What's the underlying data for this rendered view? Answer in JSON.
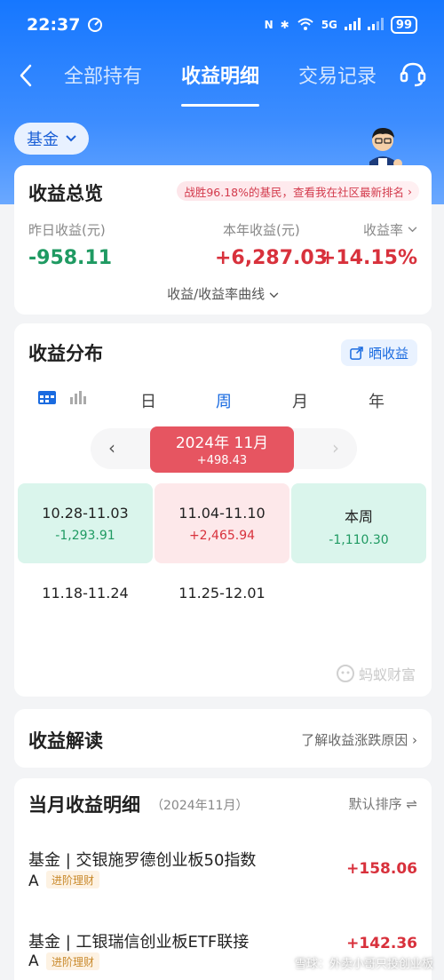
{
  "status": {
    "time": "22:37",
    "battery": "99",
    "signal": "5G"
  },
  "nav": {
    "back_icon": "back-arrow-icon",
    "tabs": [
      "全部持有",
      "收益明细",
      "交易记录"
    ],
    "active_tab": 1,
    "service_icon": "customer-service-icon"
  },
  "filter": {
    "label": "基金"
  },
  "overview": {
    "title": "收益总览",
    "rank_text": "战胜96.18%的基民，查看我在社区最新排名",
    "yesterday_label": "昨日收益(元)",
    "yesterday_value": "-958.11",
    "year_label": "本年收益(元)",
    "year_value": "+6,287.03",
    "rate_label": "收益率",
    "rate_value": "+14.15%",
    "curve_link": "收益/收益率曲线"
  },
  "distribution": {
    "title": "收益分布",
    "share_label": "晒收益",
    "periods": [
      "日",
      "周",
      "月",
      "年"
    ],
    "active_period": 1,
    "month": "2024年 11月",
    "month_value": "+498.43",
    "weeks": [
      {
        "range": "10.28-11.03",
        "value": "-1,293.91",
        "tone": "green"
      },
      {
        "range": "11.04-11.10",
        "value": "+2,465.94",
        "tone": "red"
      },
      {
        "range": "本周",
        "value": "-1,110.30",
        "tone": "green"
      },
      {
        "range": "11.18-11.24",
        "value": "",
        "tone": "none"
      },
      {
        "range": "11.25-12.01",
        "value": "",
        "tone": "none"
      }
    ],
    "watermark": "蚂蚁财富"
  },
  "interpretation": {
    "title": "收益解读",
    "link": "了解收益涨跌原因"
  },
  "monthly": {
    "title": "当月收益明细",
    "subtitle": "（2024年11月）",
    "sort_label": "默认排序",
    "funds": [
      {
        "name": "基金 | 交银施罗德创业板50指数",
        "grade": "A",
        "tag": "进阶理财",
        "value": "+158.06"
      },
      {
        "name": "基金 | 工银瑞信创业板ETF联接",
        "grade": "A",
        "tag": "进阶理财",
        "value": "+142.36"
      }
    ]
  },
  "corner_watermark": "雪球：外卖小哥只投创业板",
  "colors": {
    "brand": "#1677ff",
    "up": "#d8313c",
    "down": "#1f9a62"
  }
}
